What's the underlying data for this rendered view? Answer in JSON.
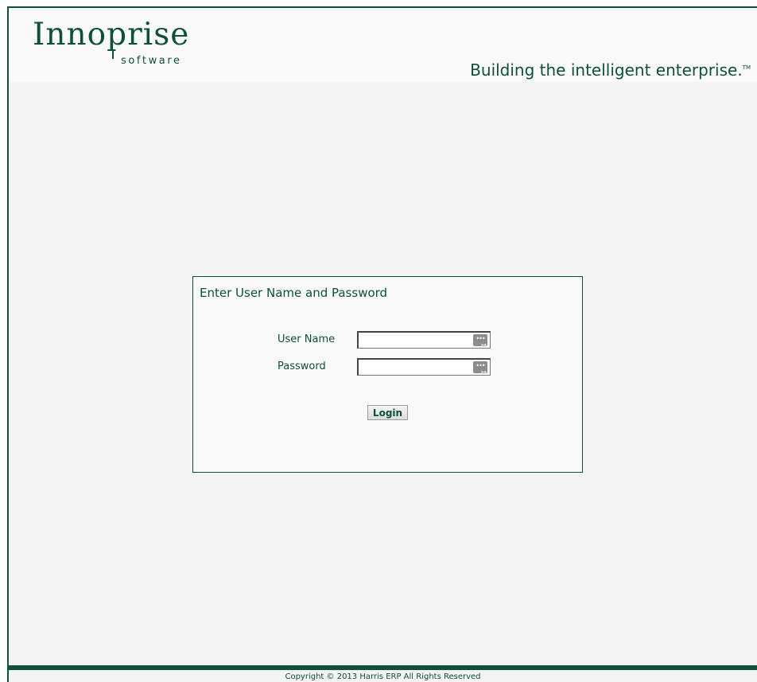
{
  "header": {
    "logo_main": "Innoprise",
    "logo_sub": "software",
    "tagline": "Building the intelligent enterprise.",
    "tagline_mark": "TM"
  },
  "login": {
    "title": "Enter User Name and Password",
    "username_label": "User Name",
    "username_value": "",
    "password_label": "Password",
    "password_value": "",
    "field_icon": "password-manager-icon",
    "button_label": "Login"
  },
  "footer": {
    "copyright": "Copyright © 2013 Harris ERP All Rights Reserved"
  },
  "colors": {
    "brand": "#0f4f3c",
    "background": "#f4f4f4",
    "header_bg": "#fafafa"
  }
}
